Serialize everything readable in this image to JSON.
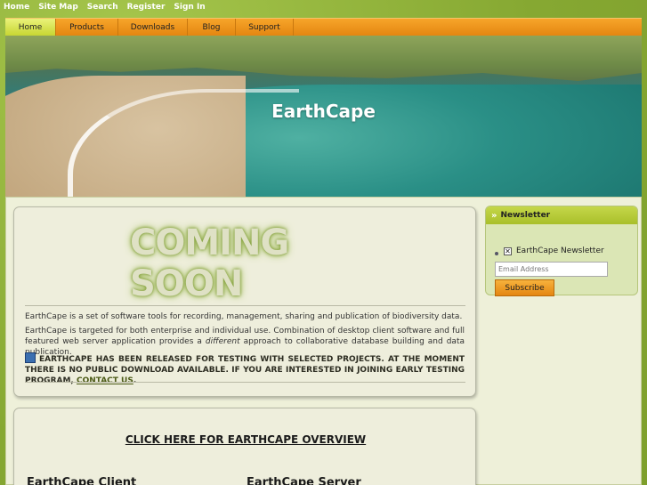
{
  "topbar": {
    "links": [
      "Home",
      "Site Map",
      "Search",
      "Register",
      "Sign In"
    ]
  },
  "nav": {
    "tabs": [
      "Home",
      "Products",
      "Downloads",
      "Blog",
      "Support"
    ],
    "active": "Home"
  },
  "hero": {
    "title": "EarthCape"
  },
  "main": {
    "coming_soon": "COMING SOON",
    "para1": "EarthCape is a set of software tools for recording, management, sharing and publication of biodiversity data.",
    "para2_a": "EarthCape is targeted for both enterprise and individual use. Combination of desktop client software and full featured web server application provides a ",
    "para2_em": "different",
    "para2_b": " approach to collaborative database building and data publication.",
    "notice": "EARTHCAPE HAS BEEN RELEASED FOR TESTING WITH SELECTED PROJECTS. AT THE MOMENT THERE IS NO PUBLIC DOWNLOAD AVAILABLE. IF YOU ARE INTERESTED IN JOINING EARLY TESTING PROGRAM, ",
    "notice_link": "CONTACT US",
    "notice_end": ".",
    "overview_link": "CLICK HERE FOR EARTHCAPE OVERVIEW",
    "client_heading": "EarthCape Client",
    "server_heading": "EarthCape Server"
  },
  "sidebar": {
    "newsletter_title": "Newsletter",
    "checkbox_label": "EarthCape Newsletter",
    "email_placeholder": "Email Address",
    "subscribe_label": "Subscribe"
  },
  "colors": {
    "background": "#8fb23a",
    "nav_orange": "#e48611",
    "active_tab": "#c7d632",
    "panel": "#eef0d9"
  }
}
